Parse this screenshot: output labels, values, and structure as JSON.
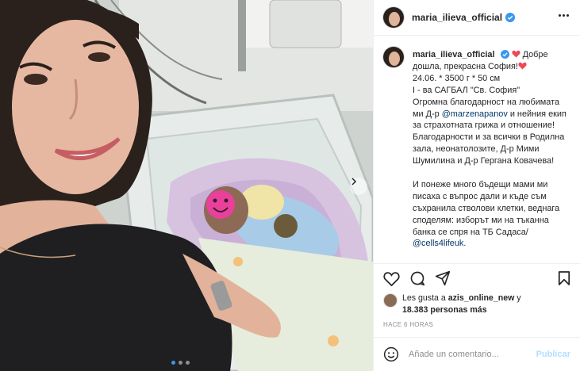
{
  "post": {
    "username": "maria_ilieva_official",
    "verified": true,
    "more_icon": "more-horizontal-icon",
    "caption": {
      "username": "maria_ilieva_official",
      "line1": " Добре дошла, прекрасна София!",
      "line2": "24.06. * 3500 г * 50 см",
      "line3": "I - ва САГБАЛ \"Св. София\"",
      "line4a": "Огромна благодарност на любимата ми Д-р ",
      "mention1": "@marzenapanov",
      "line4b": " и нейния екип за страхотната грижа и отношение!",
      "line5": "Благодарности и за всички в Родилна зала, неонатолозите, Д-р Мими Шумилина и Д-р Гергана Ковачева!",
      "line6": "И понеже много бъдещи мами ми писаха с въпрос дали и къде съм съхранила стволови клетки, веднага споделям: изборът ми на тъканна банка се спря на ТБ Садаса/",
      "mention2": "@cells4lifeuk",
      "line6_end": "."
    },
    "likes": {
      "prefix": "Les gusta a ",
      "user": "azis_online_new",
      "middle": " y",
      "count": "18.383 personas más"
    },
    "time": "HACE 6 HORAS",
    "comment": {
      "placeholder": "Añade un comentario...",
      "publish_label": "Publicar",
      "emoji_icon": "emoji-icon"
    },
    "actions": [
      "heart-icon",
      "comment-icon",
      "share-icon",
      "bookmark-icon"
    ]
  },
  "media": {
    "photo_description_icon": "photo",
    "carousel": {
      "count": 3,
      "active": 1
    }
  },
  "colors": {
    "link": "#00376b",
    "verified": "#3897f0",
    "publish_disabled": "#b2dffc",
    "heart": "#ed4956"
  }
}
